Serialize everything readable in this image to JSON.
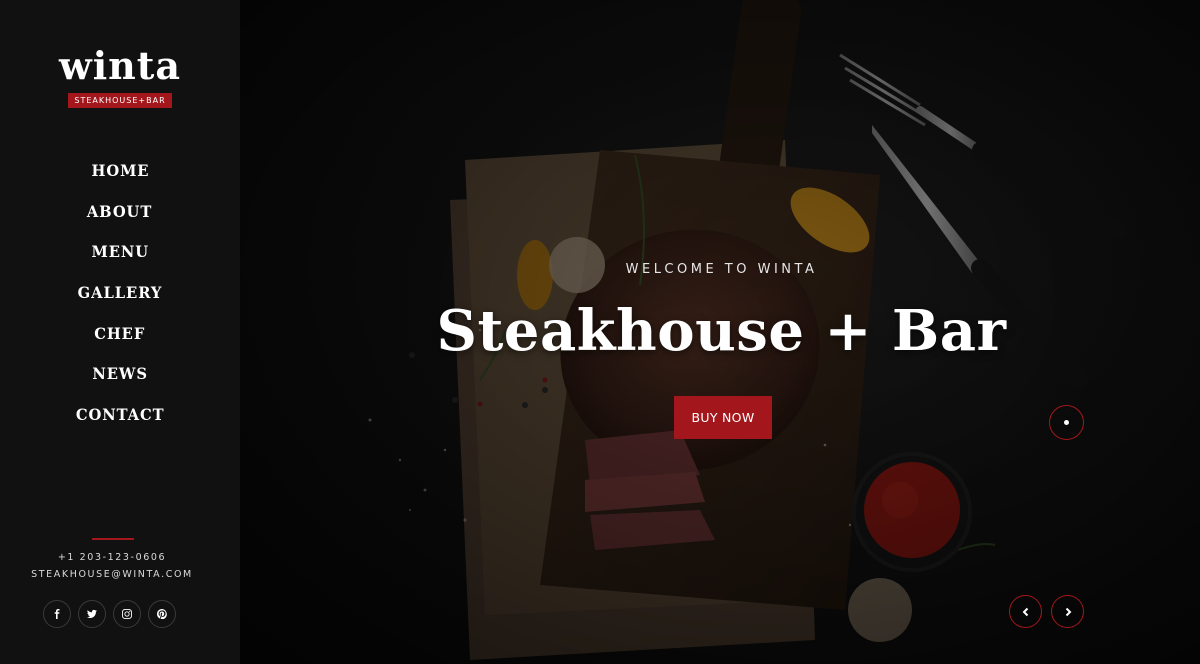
{
  "brand": {
    "name": "winta",
    "tagline": "STEAKHOUSE+BAR",
    "accent_color": "#a3171c"
  },
  "nav": {
    "items": [
      {
        "label": "HOME"
      },
      {
        "label": "ABOUT"
      },
      {
        "label": "MENU"
      },
      {
        "label": "GALLERY"
      },
      {
        "label": "CHEF"
      },
      {
        "label": "NEWS"
      },
      {
        "label": "CONTACT"
      }
    ]
  },
  "contact": {
    "phone": "+1 203-123-0606",
    "email": "STEAKHOUSE@WINTA.COM"
  },
  "socials": [
    {
      "icon": "facebook-icon"
    },
    {
      "icon": "twitter-icon"
    },
    {
      "icon": "instagram-icon"
    },
    {
      "icon": "pinterest-icon"
    }
  ],
  "hero": {
    "eyebrow": "WELCOME TO WINTA",
    "title": "Steakhouse + Bar",
    "cta_label": "BUY NOW"
  },
  "slider": {
    "prev_icon": "chevron-left-icon",
    "next_icon": "chevron-right-icon"
  }
}
